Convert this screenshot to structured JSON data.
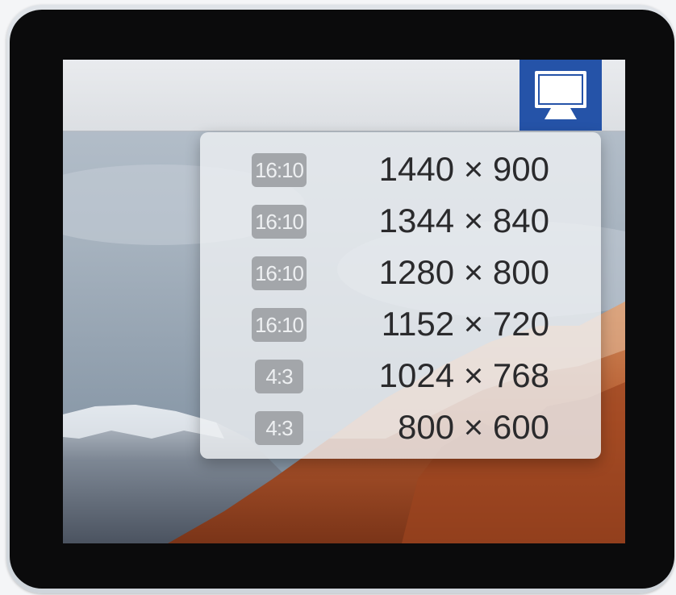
{
  "menubar": {
    "icon": "display-monitor-icon",
    "accent_color": "#2553a8"
  },
  "resolution_menu": {
    "items": [
      {
        "ratio": "16:10",
        "resolution": "1440 × 900"
      },
      {
        "ratio": "16:10",
        "resolution": "1344 × 840"
      },
      {
        "ratio": "16:10",
        "resolution": "1280 × 800"
      },
      {
        "ratio": "16:10",
        "resolution": "1152 × 720"
      },
      {
        "ratio": "4:3",
        "resolution": "1024 × 768"
      },
      {
        "ratio": "4:3",
        "resolution": "800 × 600"
      }
    ]
  }
}
